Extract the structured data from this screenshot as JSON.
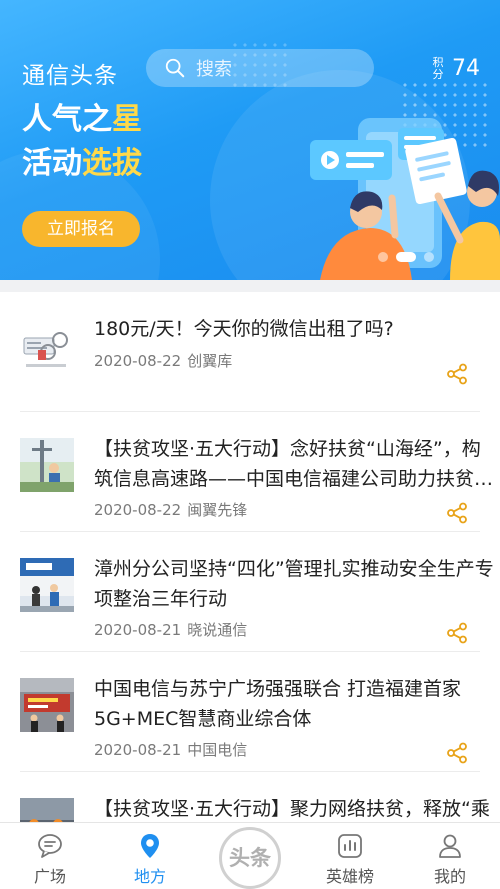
{
  "header": {
    "app_title": "通信头条",
    "search_placeholder": "搜索",
    "points_label": "积分",
    "points_value": "74"
  },
  "banner": {
    "headline_line1_a": "人气之",
    "headline_line1_b": "星",
    "headline_line2_a": "活动",
    "headline_line2_b": "选拔",
    "button_label": "立即报名",
    "page_count": 3,
    "active_page": 2
  },
  "feed": {
    "items": [
      {
        "title": "180元/天！今天你的微信出租了吗?",
        "date": "2020-08-22",
        "source": "创翼库"
      },
      {
        "title": "【扶贫攻坚·五大行动】念好扶贫“山海经”，构筑信息高速路——中国电信福建公司助力扶贫纪实",
        "date": "2020-08-22",
        "source": "闽翼先锋"
      },
      {
        "title": "漳州分公司坚持“四化”管理扎实推动安全生产专项整治三年行动",
        "date": "2020-08-21",
        "source": "晓说通信"
      },
      {
        "title": "中国电信与苏宁广场强强联合 打造福建首家5G+MEC智慧商业综合体",
        "date": "2020-08-21",
        "source": "中国电信"
      },
      {
        "title": "【扶贫攻坚·五大行动】聚力网络扶贫，释放“乘数效应”——中国电信福建公司扶贫纪实",
        "date": "",
        "source": ""
      }
    ]
  },
  "tabbar": {
    "tabs": [
      {
        "label": "广场",
        "icon": "chat-bubble-icon"
      },
      {
        "label": "地方",
        "icon": "location-pin-icon"
      },
      {
        "label": "头条",
        "icon": "headline-circle"
      },
      {
        "label": "英雄榜",
        "icon": "bar-chart-icon"
      },
      {
        "label": "我的",
        "icon": "user-icon"
      }
    ],
    "active": "地方"
  },
  "colors": {
    "banner_blue": "#1f9bf5",
    "accent_yellow": "#ffd94a",
    "button_orange": "#f8b62d",
    "active_tab_blue": "#1f8ff0",
    "share_icon_orange": "#e8a319"
  }
}
